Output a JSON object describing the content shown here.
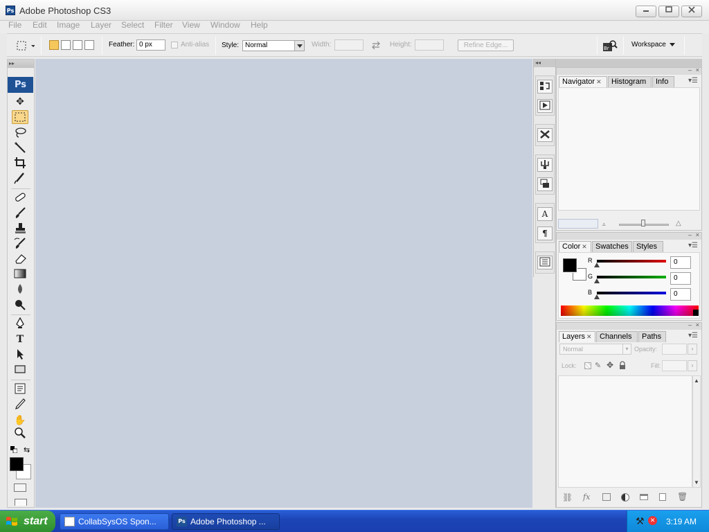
{
  "window": {
    "title": "Adobe Photoshop CS3",
    "app_icon": "Ps",
    "controls": [
      "minimize",
      "maximize",
      "close"
    ]
  },
  "menubar": {
    "items": [
      "File",
      "Edit",
      "Image",
      "Layer",
      "Select",
      "Filter",
      "View",
      "Window",
      "Help"
    ]
  },
  "options_bar": {
    "feather_label": "Feather:",
    "feather_value": "0 px",
    "antialias_label": "Anti-alias",
    "style_label": "Style:",
    "style_value": "Normal",
    "width_label": "Width:",
    "height_label": "Height:",
    "refine_edge_label": "Refine Edge...",
    "workspace_label": "Workspace"
  },
  "toolbox": {
    "logo": "Ps",
    "tools": [
      "move",
      "rectangular-marquee",
      "lasso",
      "magic-wand",
      "crop",
      "slice",
      "spot-healing",
      "brush",
      "clone-stamp",
      "history-brush",
      "eraser",
      "gradient",
      "blur",
      "dodge",
      "pen",
      "type",
      "path-selection",
      "rectangle",
      "notes",
      "eyedropper",
      "hand",
      "zoom"
    ],
    "active_tool": "rectangular-marquee"
  },
  "navigator_panel": {
    "tabs": [
      "Navigator",
      "Histogram",
      "Info"
    ],
    "active_tab": "Navigator"
  },
  "color_panel": {
    "tabs": [
      "Color",
      "Swatches",
      "Styles"
    ],
    "active_tab": "Color",
    "channels": [
      {
        "label": "R",
        "value": "0",
        "color": "#e01010"
      },
      {
        "label": "G",
        "value": "0",
        "color": "#10b010"
      },
      {
        "label": "B",
        "value": "0",
        "color": "#1010e0"
      }
    ],
    "foreground": "#000000",
    "background": "#ffffff"
  },
  "layers_panel": {
    "tabs": [
      "Layers",
      "Channels",
      "Paths"
    ],
    "active_tab": "Layers",
    "blend_mode": "Normal",
    "opacity_label": "Opacity:",
    "lock_label": "Lock:",
    "fill_label": "Fill:"
  },
  "taskbar": {
    "start_label": "start",
    "tasks": [
      {
        "label": "CollabSysOS Spon...",
        "active": false
      },
      {
        "label": "Adobe Photoshop ...",
        "active": true
      }
    ],
    "clock": "3:19 AM"
  }
}
